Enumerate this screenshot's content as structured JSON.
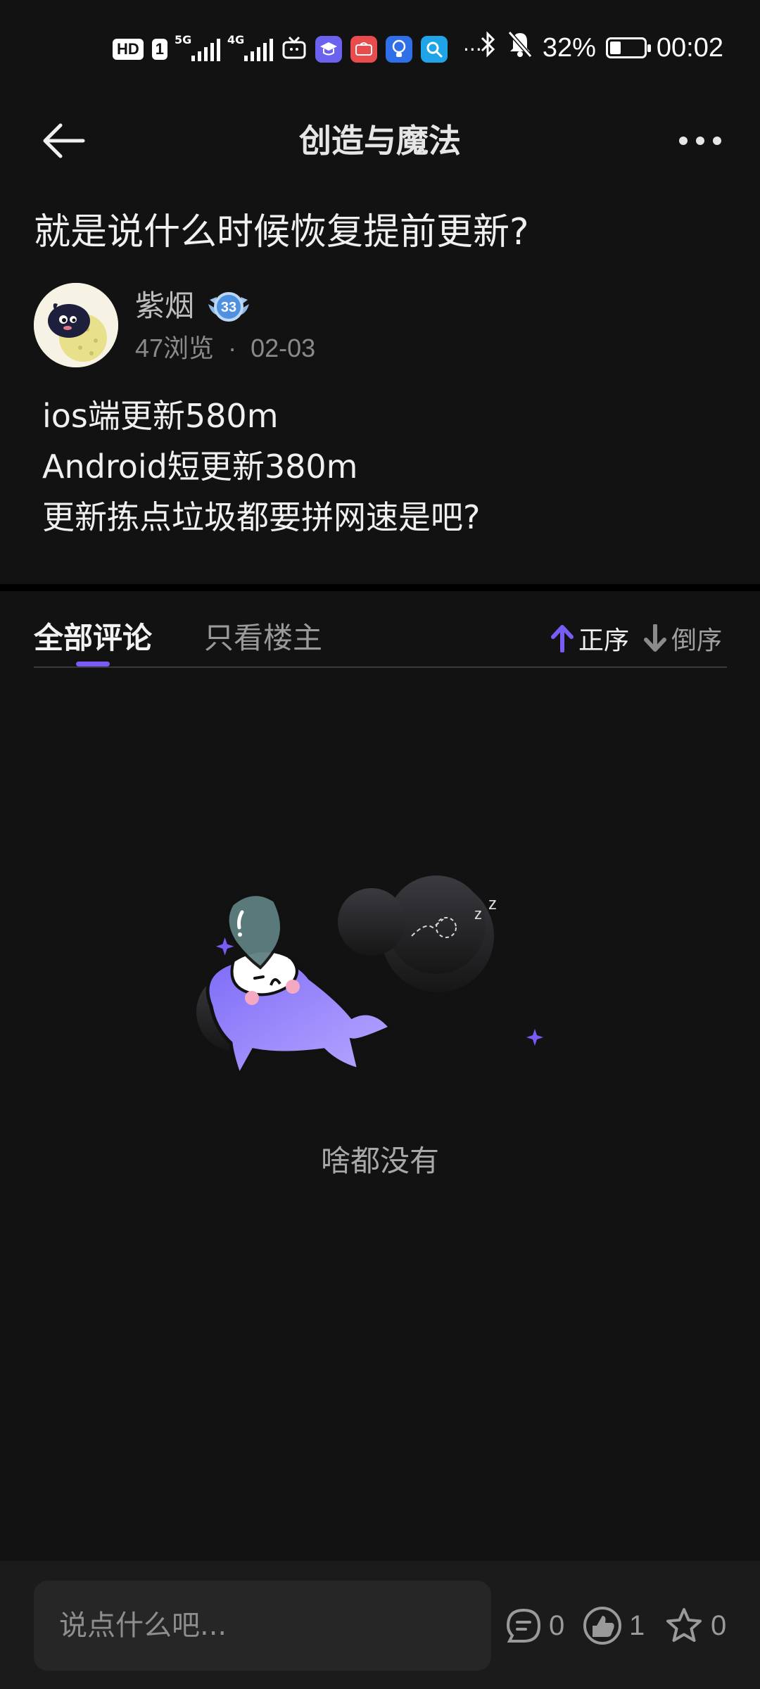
{
  "status_bar": {
    "hd_badge": "HD",
    "sim_badge": "1",
    "net1": "5G",
    "net2": "4G",
    "more": "···",
    "battery_percent": "32%",
    "battery_level": 0.32,
    "time": "00:02",
    "icons": [
      "bluetooth-icon",
      "mute-bell-icon",
      "tv-icon",
      "app-education-icon",
      "app-huawei-icon",
      "app-tips-icon",
      "app-search-icon"
    ]
  },
  "header": {
    "title": "创造与魔法",
    "back_icon": "arrow-left-icon",
    "more_icon": "more-dots-icon"
  },
  "post": {
    "title": "就是说什么时候恢复提前更新?",
    "author": "紫烟",
    "level": "33",
    "views": "47浏览",
    "separator": "·",
    "date": "02-03",
    "body_lines": [
      "ios端更新580m",
      "Android短更新380m",
      "更新拣点垃圾都要拼网速是吧?"
    ]
  },
  "comments": {
    "tabs": [
      "全部评论",
      "只看楼主"
    ],
    "active_tab": 0,
    "sort_asc": "正序",
    "sort_desc": "倒序",
    "empty_text": "啥都没有"
  },
  "bottom_bar": {
    "placeholder": "说点什么吧...",
    "comment_count": "0",
    "like_count": "1",
    "favorite_count": "0"
  },
  "colors": {
    "background": "#121212",
    "accent": "#7a5cf5",
    "bottom_bar": "#1b1b1b"
  }
}
